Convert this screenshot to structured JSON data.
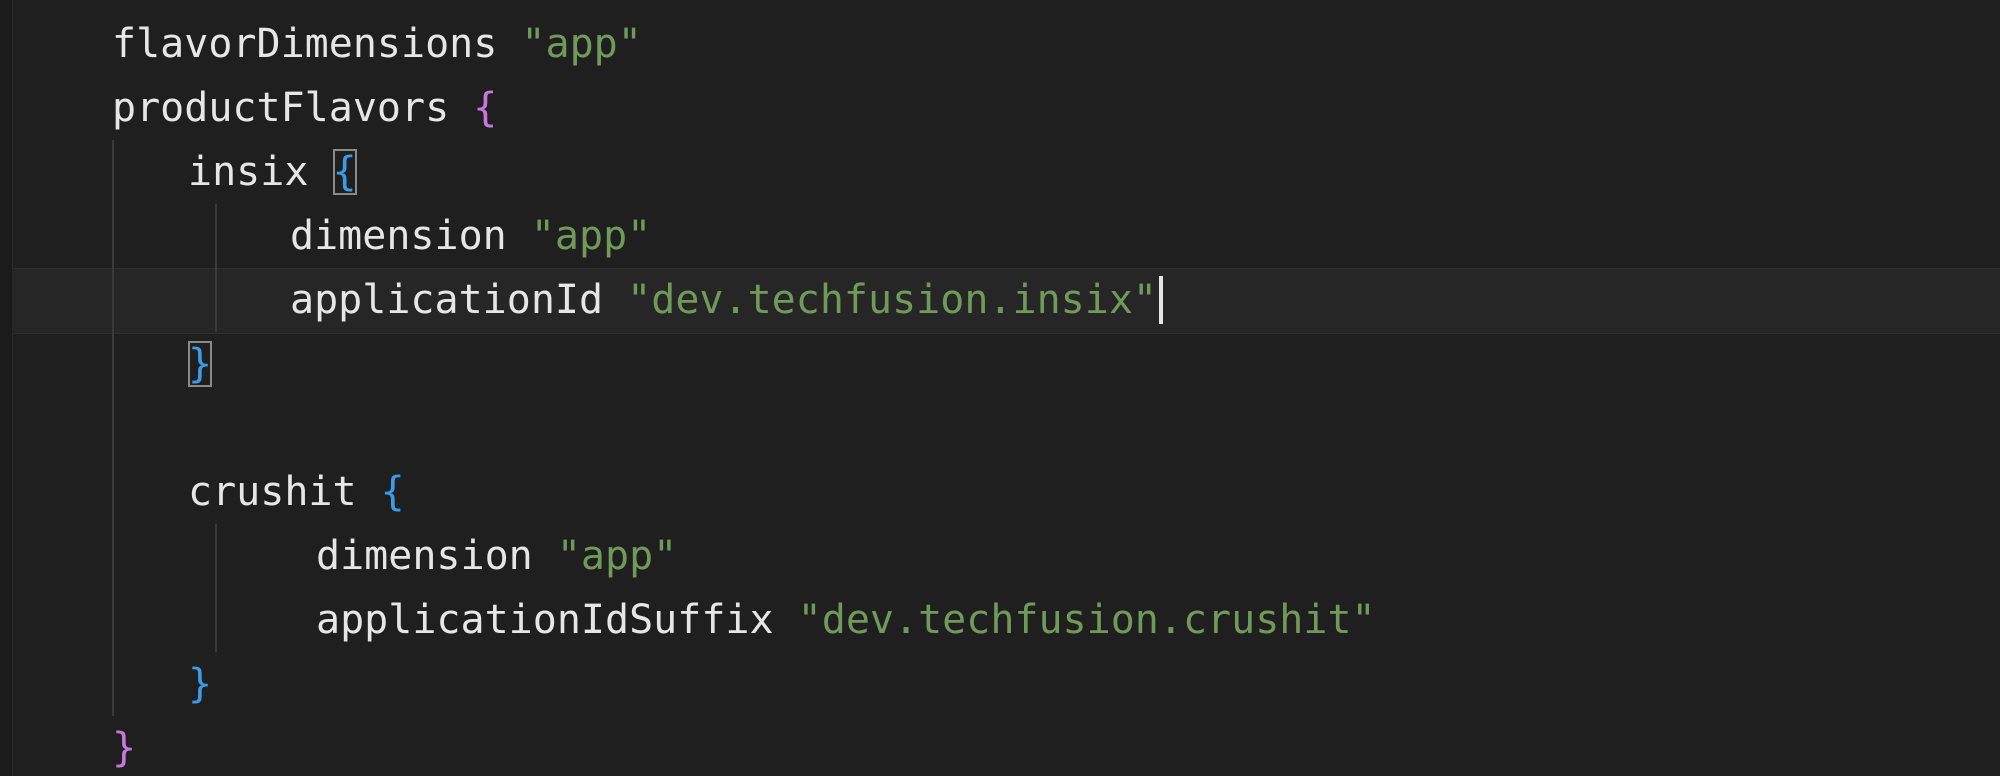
{
  "editor": {
    "lines": [
      {
        "keyword": "flavorDimensions",
        "value": "\"app\""
      },
      {
        "keyword": "productFlavors",
        "brace": "{"
      },
      {
        "keyword": "insix",
        "brace": "{"
      },
      {
        "keyword": "dimension",
        "value": "\"app\""
      },
      {
        "keyword": "applicationId",
        "value": "\"dev.techfusion.insix\""
      },
      {
        "brace": "}"
      },
      {
        "keyword": "crushit",
        "brace": "{"
      },
      {
        "keyword": "dimension",
        "value": "\"app\""
      },
      {
        "keyword": "applicationIdSuffix",
        "value": "\"dev.techfusion.crushit\""
      },
      {
        "brace": "}"
      },
      {
        "brace": "}"
      }
    ]
  },
  "colors": {
    "background": "#1f1f1f",
    "identifier": "#e6e6e6",
    "string": "#6f9a5a",
    "brace_level1": "#c678dd",
    "brace_level2": "#3b9be8"
  }
}
